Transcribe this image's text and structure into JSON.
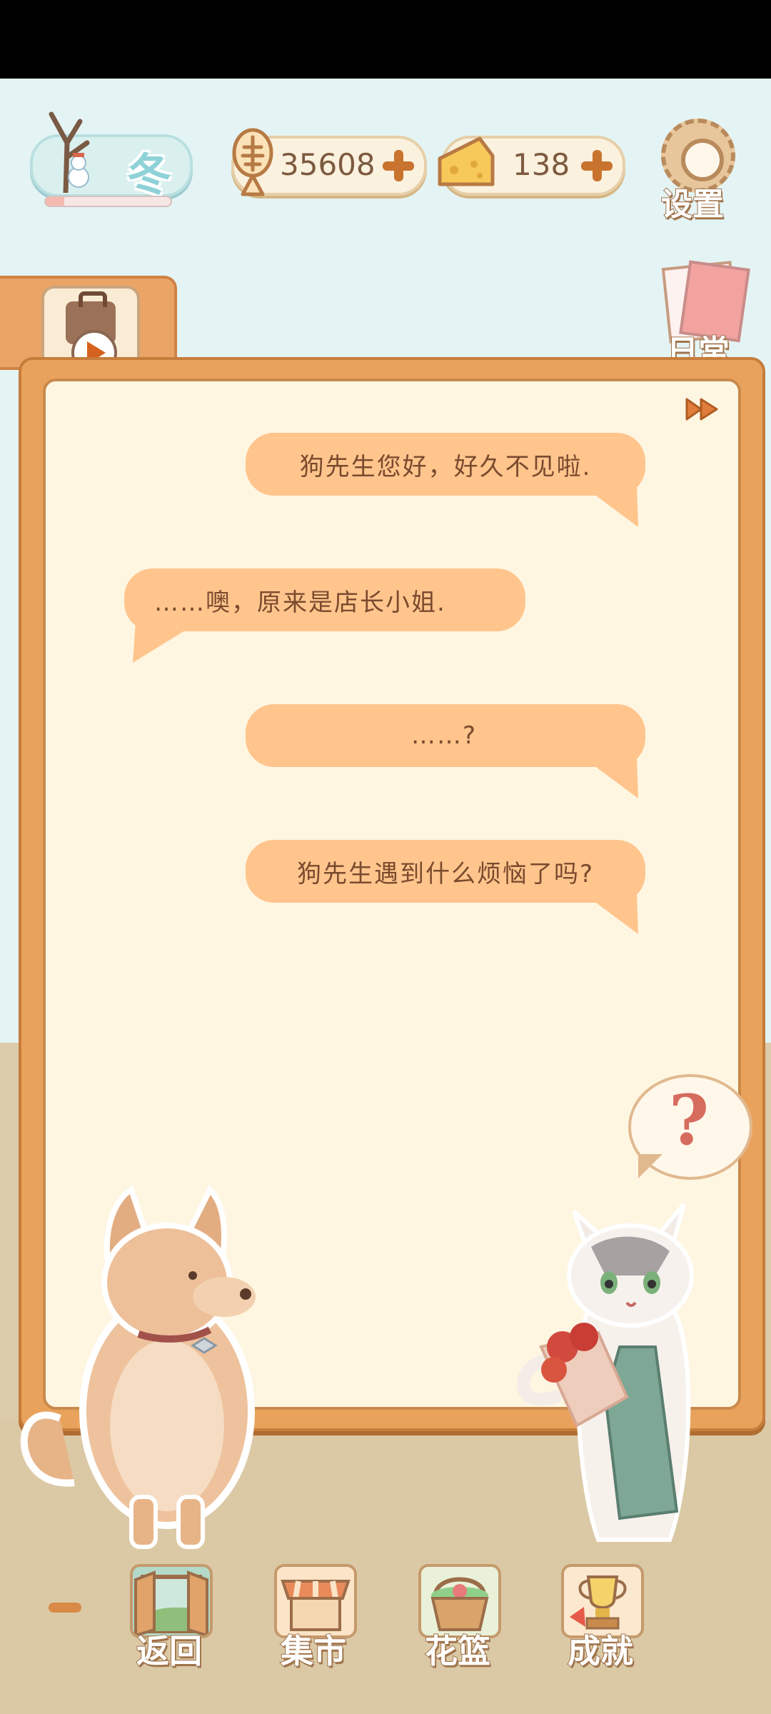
{
  "hud": {
    "season_label": "冬",
    "season_progress": 0.15,
    "fish_bones": "35608",
    "cheese": "138",
    "settings_label": "设置",
    "daily_label": "日常"
  },
  "dialog": {
    "messages": [
      {
        "speaker": "cat",
        "text": "狗先生您好，好久不见啦."
      },
      {
        "speaker": "dog",
        "text": "……噢，原来是店长小姐."
      },
      {
        "speaker": "cat",
        "text": "……?"
      },
      {
        "speaker": "cat",
        "text": "狗先生遇到什么烦恼了吗?"
      }
    ],
    "hint_symbol": "?"
  },
  "nav": {
    "back": "返回",
    "market": "集市",
    "basket": "花篮",
    "achievements": "成就"
  },
  "colors": {
    "frame": "#e9a25c",
    "bubble": "#ffc58d",
    "paper": "#fff6e2",
    "accent": "#c8742f"
  }
}
